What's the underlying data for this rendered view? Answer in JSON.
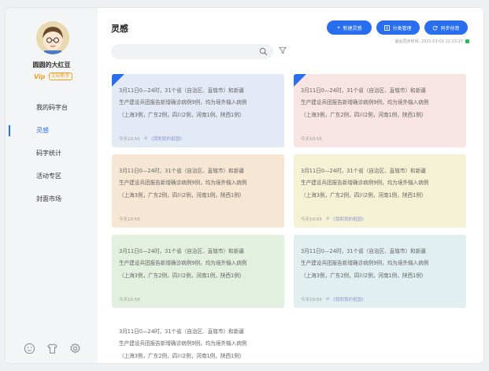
{
  "user": {
    "name": "圆圆的大红豆",
    "vip": "Vip",
    "badge": "文坛新手"
  },
  "nav": [
    {
      "label": "我的码字台",
      "active": false
    },
    {
      "label": "灵感",
      "active": true
    },
    {
      "label": "码字统计",
      "active": false
    },
    {
      "label": "活动专区",
      "active": false
    },
    {
      "label": "封面市场",
      "active": false
    }
  ],
  "sidebar_bottom_icons": [
    "smile-icon",
    "shirt-icon",
    "settings-icon"
  ],
  "main": {
    "title": "灵感",
    "search_placeholder": "",
    "buttons": {
      "new": "新建灵感",
      "category": "分类管理",
      "sync": "同步创意"
    },
    "sync_time": "最后同步时间: 2021-03-01 12:23:27",
    "accent": "#2a6ef0"
  },
  "cards": [
    {
      "line1": "3月11日0—24时，31个省（自治区、直辖市）和新疆",
      "line2": "生产建设兵团报告新增确诊病例9例，均为境外输入病例",
      "line3": "（上海3例，广东2例，四川2例，河南1例，陕西1例）",
      "time": "今天10:55",
      "link": "《我和我的祖国》",
      "bg": "#e3e9f5",
      "flagged": true
    },
    {
      "line1": "3月11日0—24时，31个省（自治区、直辖市）和新疆",
      "line2": "生产建设兵团报告新增确诊病例9例，均为境外输入病例",
      "line3": "（上海3例，广东2例，四川2例，河南1例，陕西1例）",
      "time": "今天10:55",
      "link": "",
      "bg": "#f8e4e2",
      "flagged": true
    },
    {
      "line1": "3月11日0—24时，31个省（自治区、直辖市）和新疆",
      "line2": "生产建设兵团报告新增确诊病例9例，均为境外输入病例",
      "line3": "（上海3例，广东2例，四川2例，河南1例，陕西1例）",
      "time": "今天10:55",
      "link": "",
      "bg": "#f7e6d3",
      "flagged": false
    },
    {
      "line1": "3月11日0—24时，31个省（自治区、直辖市）和新疆",
      "line2": "生产建设兵团报告新增确诊病例9例，均为境外输入病例",
      "line3": "（上海3例，广东2例，四川2例，河南1例，陕西1例）",
      "time": "今天10:55",
      "link": "《我和我的祖国》",
      "bg": "#f5f1d4",
      "flagged": false
    },
    {
      "line1": "3月11日0—24时，31个省（自治区、直辖市）和新疆",
      "line2": "生产建设兵团报告新增确诊病例9例，均为境外输入病例",
      "line3": "（上海3例，广东2例，四川2例，河南1例，陕西1例）",
      "time": "今天10:55",
      "link": "",
      "bg": "#e4f0df",
      "flagged": false
    },
    {
      "line1": "3月11日0—24时，31个省（自治区、直辖市）和新疆",
      "line2": "生产建设兵团报告新增确诊病例9例，均为境外输入病例",
      "line3": "（上海3例，广东2例，四川2例，河南1例，陕西1例）",
      "time": "今天10:55",
      "link": "《我和我的祖国》",
      "bg": "#e1eff0",
      "flagged": false
    },
    {
      "line1": "3月11日0—24时，31个省（自治区、直辖市）和新疆",
      "line2": "生产建设兵团报告新增确诊病例9例，均为境外输入病例",
      "line3": "（上海3例，广东2例，四川2例，河南1例，陕西1例）",
      "time": "",
      "link": "",
      "bg": "#ffffff",
      "flagged": false
    }
  ]
}
